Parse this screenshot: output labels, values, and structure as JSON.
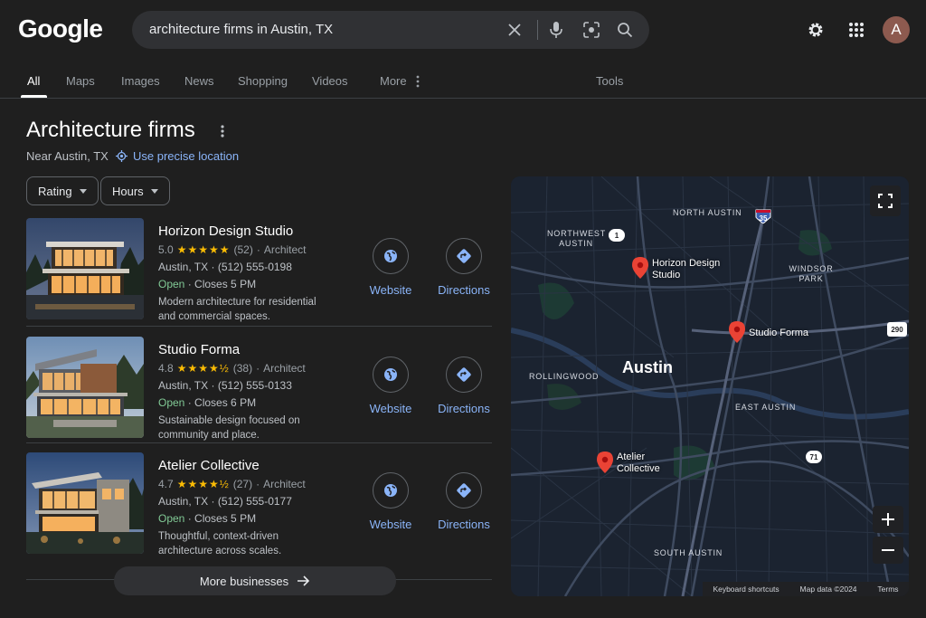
{
  "header": {
    "logo": "Google",
    "search_value": "architecture firms in Austin, TX",
    "avatar_letter": "A"
  },
  "tabs": [
    {
      "label": "All",
      "active": true
    },
    {
      "label": "Maps"
    },
    {
      "label": "Images"
    },
    {
      "label": "News"
    },
    {
      "label": "Shopping"
    },
    {
      "label": "Videos"
    },
    {
      "label": "More"
    },
    {
      "label": "Tools"
    }
  ],
  "local": {
    "title": "Architecture firms",
    "near": "Near Austin, TX",
    "precise_link": "Use precise location",
    "filters": [
      "Rating",
      "Hours"
    ],
    "more_businesses": "More businesses"
  },
  "listings": [
    {
      "name": "Horizon Design Studio",
      "rating": "5.0",
      "stars": "★★★★★",
      "reviews": "(52)",
      "category": "Architect",
      "city": "Austin, TX",
      "phone": "(512) 555-0198",
      "status": "Open",
      "closes": "Closes 5 PM",
      "description": "Modern architecture for residential and commercial spaces.",
      "website_label": "Website",
      "directions_label": "Directions"
    },
    {
      "name": "Studio Forma",
      "rating": "4.8",
      "stars": "★★★★½",
      "reviews": "(38)",
      "category": "Architect",
      "city": "Austin, TX",
      "phone": "(512) 555-0133",
      "status": "Open",
      "closes": "Closes 6 PM",
      "description": "Sustainable design focused on community and place.",
      "website_label": "Website",
      "directions_label": "Directions"
    },
    {
      "name": "Atelier Collective",
      "rating": "4.7",
      "stars": "★★★★½",
      "reviews": "(27)",
      "category": "Architect",
      "city": "Austin, TX",
      "phone": "(512) 555-0177",
      "status": "Open",
      "closes": "Closes 5 PM",
      "description": "Thoughtful, context-driven architecture across scales.",
      "website_label": "Website",
      "directions_label": "Directions"
    }
  ],
  "map": {
    "city": "Austin",
    "areas": [
      "NORTH AUSTIN",
      "NORTHWEST AUSTIN",
      "WINDSOR PARK",
      "ROLLINGWOOD",
      "EAST AUSTIN",
      "SOUTH AUSTIN"
    ],
    "pins": [
      "Horizon Design Studio",
      "Studio Forma",
      "Atelier Collective"
    ],
    "shields": [
      "35",
      "1",
      "290",
      "71"
    ],
    "footer": [
      "Keyboard shortcuts",
      "Map data ©2024",
      "Terms"
    ]
  },
  "colors": {
    "background": "#1f1f1f",
    "link": "#8ab4f8",
    "open": "#81c995",
    "star": "#fbbc04",
    "pin": "#ea4335"
  }
}
